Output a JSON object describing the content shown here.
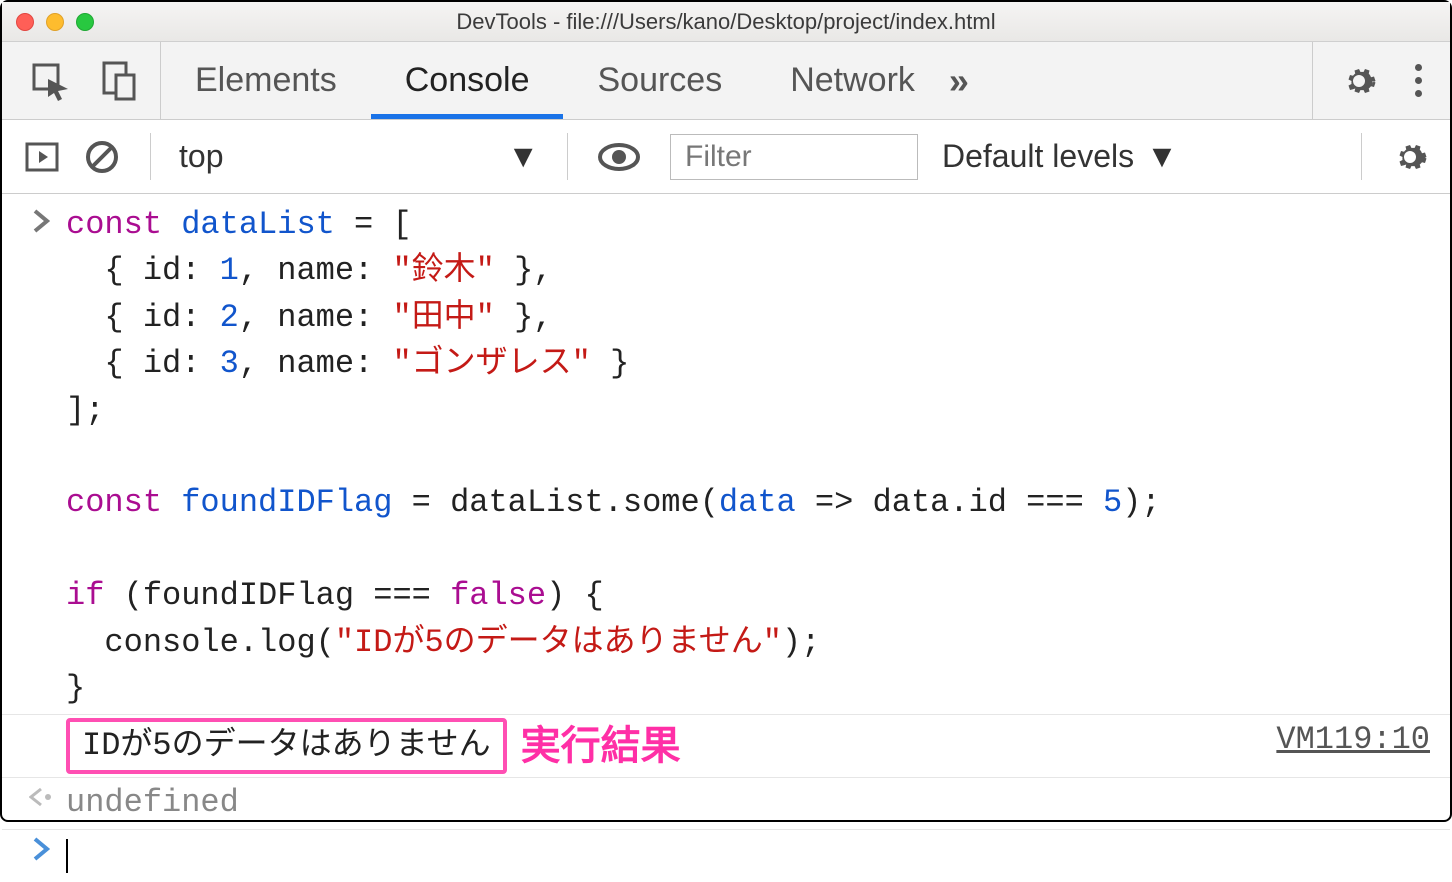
{
  "window": {
    "title": "DevTools - file:///Users/kano/Desktop/project/index.html"
  },
  "tabs": {
    "elements": "Elements",
    "console": "Console",
    "sources": "Sources",
    "network": "Network"
  },
  "toolbar": {
    "context": "top",
    "filter_placeholder": "Filter",
    "levels": "Default levels"
  },
  "code": {
    "l1_kw": "const",
    "l1_var": " dataList",
    "l1_rest": " = [",
    "l2a": "  { id: ",
    "l2n": "1",
    "l2m": ", name: ",
    "l2s": "\"鈴木\"",
    "l2e": " },",
    "l3a": "  { id: ",
    "l3n": "2",
    "l3m": ", name: ",
    "l3s": "\"田中\"",
    "l3e": " },",
    "l4a": "  { id: ",
    "l4n": "3",
    "l4m": ", name: ",
    "l4s": "\"ゴンザレス\"",
    "l4e": " }",
    "l5": "];",
    "l6": "",
    "l7_kw": "const",
    "l7_var": " foundIDFlag",
    "l7_rest1": " = dataList.some(",
    "l7_arg": "data",
    "l7_arrow": " => ",
    "l7_expr": "data.id === ",
    "l7_num": "5",
    "l7_end": ");",
    "l8": "",
    "l9_kw": "if",
    "l9_rest1": " (foundIDFlag === ",
    "l9_false": "false",
    "l9_rest2": ") {",
    "l10a": "  console.log(",
    "l10s": "\"IDが5のデータはありません\"",
    "l10e": ");",
    "l11": "}"
  },
  "output": {
    "text": "IDが5のデータはありません",
    "annotation": "実行結果",
    "source": "VM119:10"
  },
  "return": {
    "value": "undefined"
  }
}
